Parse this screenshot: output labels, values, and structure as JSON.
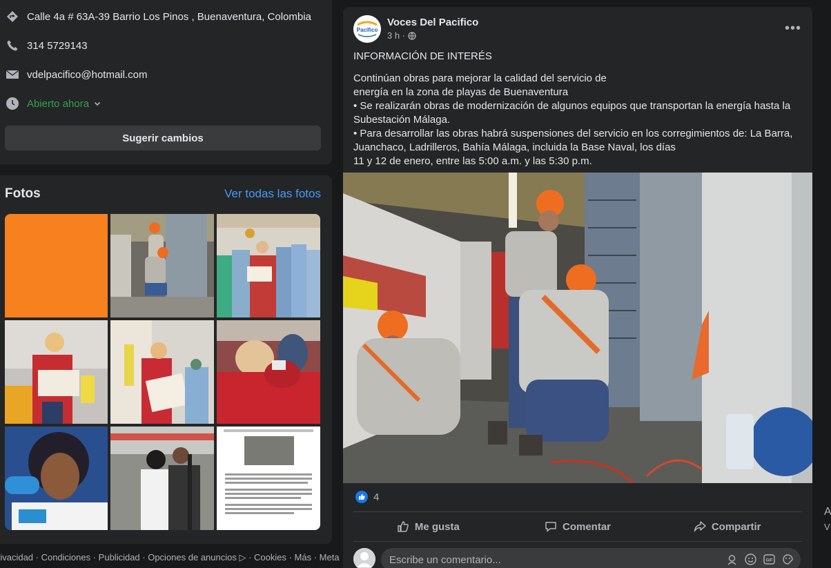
{
  "contact": {
    "address": "Calle 4a # 63A-39 Barrio Los Pinos , Buenaventura, Colombia",
    "phone": "314 5729143",
    "email": "vdelpacifico@hotmail.com",
    "hours": "Abierto ahora",
    "suggest_button": "Sugerir cambios"
  },
  "photos": {
    "title": "Fotos",
    "see_all": "Ver todas las fotos"
  },
  "footer": "rivacidad · Condiciones · Publicidad · Opciones de anuncios ▷ · Cookies · Más · Meta",
  "post": {
    "page_name": "Voces Del Pacifico",
    "time": "3 h ·",
    "avatar_text": "Pacífico",
    "heading": "INFORMACIÓN DE INTERÉS",
    "body_lines": [
      "Continúan obras para mejorar la calidad del servicio de",
      "energía en la zona de playas de Buenaventura",
      "• Se realizarán obras de modernización de algunos equipos que transportan la energía hasta la Subestación Málaga.",
      "• Para desarrollar las obras habrá suspensiones del servicio en los corregimientos de: La Barra, Juanchaco, Ladrilleros, Bahía Málaga, incluida la Base Naval, los días",
      "11 y 12 de enero, entre las 5:00 a.m. y las 5:30 p.m."
    ],
    "reaction_count": "4",
    "actions": {
      "like": "Me gusta",
      "comment": "Comentar",
      "share": "Compartir"
    },
    "comment_placeholder": "Escribe un comentario...",
    "gif_label": "GIF"
  },
  "side_cut": {
    "a": "A",
    "v": "V"
  },
  "colors": {
    "background": "#18191a",
    "card": "#242526",
    "link": "#4599ff",
    "open_green": "#31a24c",
    "like_blue": "#1877f2"
  }
}
